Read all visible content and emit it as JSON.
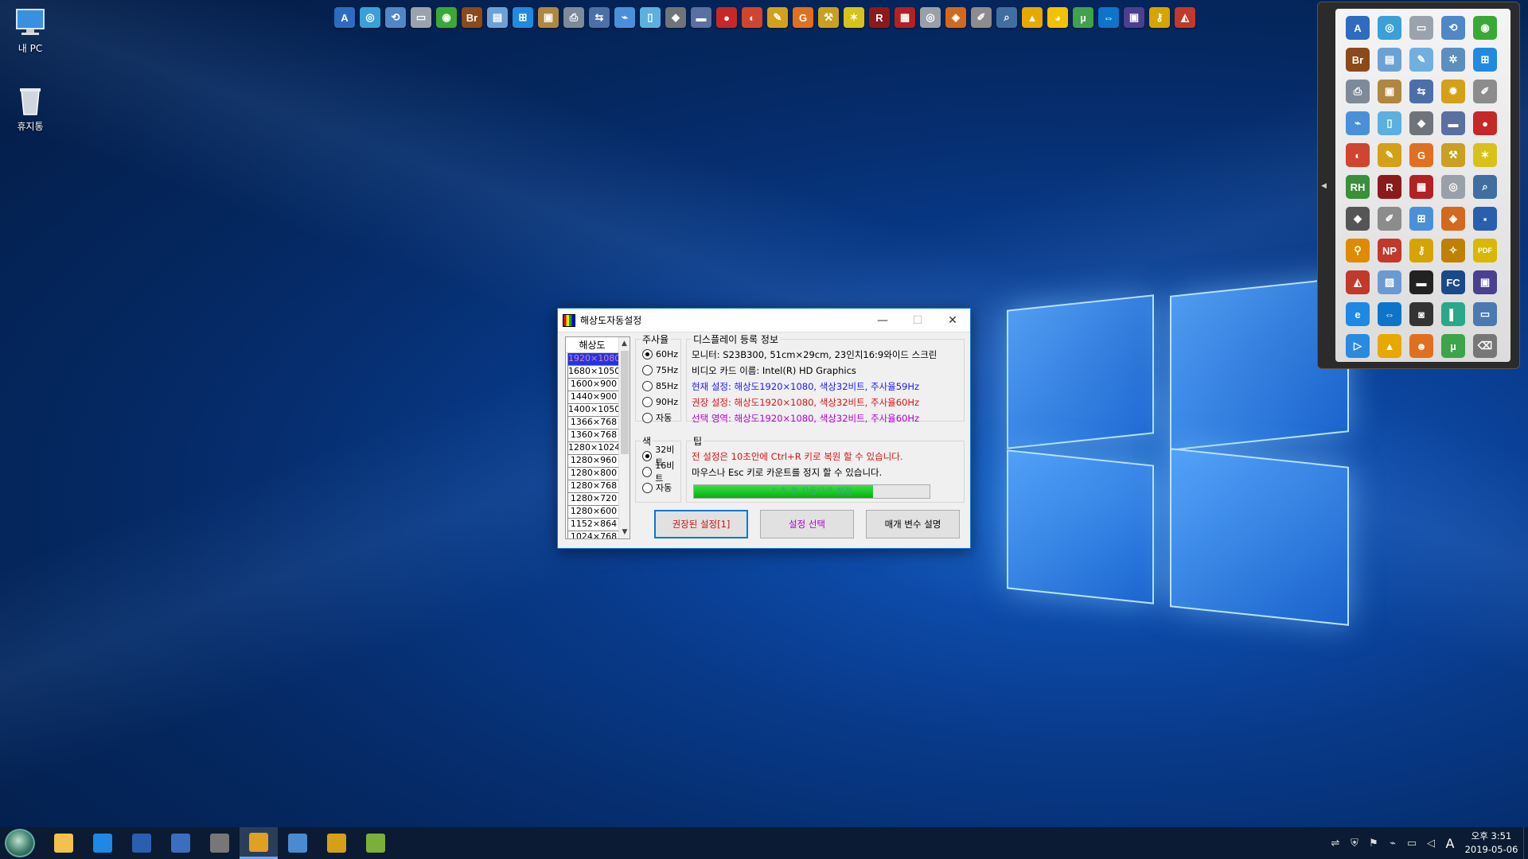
{
  "desktop": {
    "icons": [
      {
        "label": "내 PC",
        "icon": "computer-icon"
      },
      {
        "label": "휴지통",
        "icon": "recycle-bin-icon"
      }
    ]
  },
  "quicklaunch": {
    "icons": [
      {
        "icon": "a-app-icon",
        "glyph": "A",
        "color": "#2d6cc0"
      },
      {
        "icon": "disk-icon",
        "glyph": "◎",
        "color": "#3aa0d8"
      },
      {
        "icon": "backup-icon",
        "glyph": "⟲",
        "color": "#4f87c7"
      },
      {
        "icon": "drive-icon",
        "glyph": "▭",
        "color": "#9aa3ad"
      },
      {
        "icon": "hdd-green-icon",
        "glyph": "◉",
        "color": "#39a936"
      },
      {
        "icon": "bridge-icon",
        "glyph": "Br",
        "color": "#8a4a1a"
      },
      {
        "icon": "stack-icon",
        "glyph": "▤",
        "color": "#6ba2d6"
      },
      {
        "icon": "windows-icon",
        "glyph": "⊞",
        "color": "#1f8ae0"
      },
      {
        "icon": "box-icon",
        "glyph": "▣",
        "color": "#b0873f"
      },
      {
        "icon": "printer-icon",
        "glyph": "⎙",
        "color": "#7d8a99"
      },
      {
        "icon": "network-icon",
        "glyph": "⇆",
        "color": "#4c6fa8"
      },
      {
        "icon": "usb-icon",
        "glyph": "⌁",
        "color": "#4a90d9"
      },
      {
        "icon": "page-icon",
        "glyph": "▯",
        "color": "#5ab0e0"
      },
      {
        "icon": "diamond-icon",
        "glyph": "◆",
        "color": "#6f747a"
      },
      {
        "icon": "monitor-icon",
        "glyph": "▬",
        "color": "#5970a0"
      },
      {
        "icon": "ladybug-icon",
        "glyph": "●",
        "color": "#c62828"
      },
      {
        "icon": "parrot-icon",
        "glyph": "◐",
        "color": "#d0452f"
      },
      {
        "icon": "tools-icon",
        "glyph": "✎",
        "color": "#d4a017"
      },
      {
        "icon": "g-app-icon",
        "glyph": "G",
        "color": "#e07020"
      },
      {
        "icon": "wrench-icon",
        "glyph": "⚒",
        "color": "#c9a020"
      },
      {
        "icon": "stars-icon",
        "glyph": "✶",
        "color": "#d8c21a"
      },
      {
        "icon": "r-app-icon",
        "glyph": "R",
        "color": "#8b1a1a"
      },
      {
        "icon": "puzzle-icon",
        "glyph": "▦",
        "color": "#b22222"
      },
      {
        "icon": "cd-icon",
        "glyph": "◎",
        "color": "#9aa0a8"
      },
      {
        "icon": "package-icon",
        "glyph": "◈",
        "color": "#d2691e"
      },
      {
        "icon": "pen-icon",
        "glyph": "✐",
        "color": "#8c8c8c"
      },
      {
        "icon": "search-disk-icon",
        "glyph": "⌕",
        "color": "#3f6fa0"
      },
      {
        "icon": "triangle-icon",
        "glyph": "▲",
        "color": "#e8a800"
      },
      {
        "icon": "pacman-icon",
        "glyph": "◕",
        "color": "#f2c200"
      },
      {
        "icon": "utorrent-icon",
        "glyph": "µ",
        "color": "#3ea34a"
      },
      {
        "icon": "teamviewer-icon",
        "glyph": "⇔",
        "color": "#0e74c9"
      },
      {
        "icon": "chip-icon",
        "glyph": "▣",
        "color": "#4b3f8f"
      },
      {
        "icon": "key-icon",
        "glyph": "⚷",
        "color": "#d6a400"
      },
      {
        "icon": "umbrella-icon",
        "glyph": "◭",
        "color": "#c0392b"
      }
    ]
  },
  "dock": {
    "icons": [
      {
        "icon": "a-app-icon",
        "glyph": "A",
        "color": "#2d6cc0"
      },
      {
        "icon": "disk-icon",
        "glyph": "◎",
        "color": "#3aa0d8"
      },
      {
        "icon": "drive-icon",
        "glyph": "▭",
        "color": "#9aa3ad"
      },
      {
        "icon": "backup-icon",
        "glyph": "⟲",
        "color": "#4f87c7"
      },
      {
        "icon": "hdd-green-icon",
        "glyph": "◉",
        "color": "#39a936"
      },
      {
        "icon": "bridge-icon",
        "glyph": "Br",
        "color": "#8a4a1a"
      },
      {
        "icon": "stack-icon",
        "glyph": "▤",
        "color": "#6ba2d6"
      },
      {
        "icon": "tools-icon",
        "glyph": "✎",
        "color": "#6fb0e0"
      },
      {
        "icon": "gear-icon",
        "glyph": "✲",
        "color": "#5a8fc0"
      },
      {
        "icon": "windows-icon",
        "glyph": "⊞",
        "color": "#1f8ae0"
      },
      {
        "icon": "printer-icon",
        "glyph": "⎙",
        "color": "#7d8a99"
      },
      {
        "icon": "box-icon",
        "glyph": "▣",
        "color": "#b0873f"
      },
      {
        "icon": "network-icon",
        "glyph": "⇆",
        "color": "#4c6fa8"
      },
      {
        "icon": "settings-icon",
        "glyph": "✹",
        "color": "#d4a017"
      },
      {
        "icon": "cleaner-icon",
        "glyph": "✐",
        "color": "#8c8c8c"
      },
      {
        "icon": "usb-icon",
        "glyph": "⌁",
        "color": "#4a90d9"
      },
      {
        "icon": "page-icon",
        "glyph": "▯",
        "color": "#5ab0e0"
      },
      {
        "icon": "diamond-icon",
        "glyph": "◆",
        "color": "#6f747a"
      },
      {
        "icon": "monitor-icon",
        "glyph": "▬",
        "color": "#5970a0"
      },
      {
        "icon": "ladybug-icon",
        "glyph": "●",
        "color": "#c62828"
      },
      {
        "icon": "parrot-icon",
        "glyph": "◐",
        "color": "#d0452f"
      },
      {
        "icon": "tools-icon",
        "glyph": "✎",
        "color": "#d4a017"
      },
      {
        "icon": "g-app-icon",
        "glyph": "G",
        "color": "#e07020"
      },
      {
        "icon": "wrench-icon",
        "glyph": "⚒",
        "color": "#c9a020"
      },
      {
        "icon": "stars-icon",
        "glyph": "✶",
        "color": "#d8c21a"
      },
      {
        "icon": "rh-app-icon",
        "glyph": "RH",
        "color": "#3a8f3a"
      },
      {
        "icon": "r-app-icon",
        "glyph": "R",
        "color": "#8b1a1a"
      },
      {
        "icon": "puzzle-icon",
        "glyph": "▦",
        "color": "#b22222"
      },
      {
        "icon": "cd-icon",
        "glyph": "◎",
        "color": "#9aa0a8"
      },
      {
        "icon": "search-disk-icon",
        "glyph": "⌕",
        "color": "#3f6fa0"
      },
      {
        "icon": "diamond-icon",
        "glyph": "◆",
        "color": "#555"
      },
      {
        "icon": "pen-icon",
        "glyph": "✐",
        "color": "#8c8c8c"
      },
      {
        "icon": "windows-icon",
        "glyph": "⊞",
        "color": "#4a90d9"
      },
      {
        "icon": "package-icon",
        "glyph": "◈",
        "color": "#d2691e"
      },
      {
        "icon": "floppy-icon",
        "glyph": "▪",
        "color": "#2a5fb0"
      },
      {
        "icon": "magnifier-icon",
        "glyph": "⚲",
        "color": "#e08a00"
      },
      {
        "icon": "np-app-icon",
        "glyph": "NP",
        "color": "#c0392b"
      },
      {
        "icon": "key-icon",
        "glyph": "⚷",
        "color": "#d6a400"
      },
      {
        "icon": "wand-icon",
        "glyph": "✧",
        "color": "#c08000"
      },
      {
        "icon": "pdf-icon",
        "glyph": "PDF",
        "color": "#d8b800"
      },
      {
        "icon": "umbrella-icon",
        "glyph": "◭",
        "color": "#c0392b"
      },
      {
        "icon": "photo-icon",
        "glyph": "▨",
        "color": "#6b9ad0"
      },
      {
        "icon": "screen-icon",
        "glyph": "▬",
        "color": "#222"
      },
      {
        "icon": "fc-app-icon",
        "glyph": "FC",
        "color": "#1a4a8a"
      },
      {
        "icon": "chip-icon",
        "glyph": "▣",
        "color": "#4b3f8f"
      },
      {
        "icon": "ie-icon",
        "glyph": "e",
        "color": "#1e88e5"
      },
      {
        "icon": "teamviewer-icon",
        "glyph": "⇔",
        "color": "#0e74c9"
      },
      {
        "icon": "camera-icon",
        "glyph": "◙",
        "color": "#333"
      },
      {
        "icon": "panel-icon",
        "glyph": "▌",
        "color": "#2aa88a"
      },
      {
        "icon": "remote-desktop-icon",
        "glyph": "▭",
        "color": "#4a7ab0"
      },
      {
        "icon": "play-icon",
        "glyph": "▷",
        "color": "#2a8ae0"
      },
      {
        "icon": "triangle-icon",
        "glyph": "▲",
        "color": "#e8a800"
      },
      {
        "icon": "face-icon",
        "glyph": "☻",
        "color": "#e07020"
      },
      {
        "icon": "utorrent-icon",
        "glyph": "µ",
        "color": "#3ea34a"
      },
      {
        "icon": "trash-icon",
        "glyph": "⌫",
        "color": "#777"
      }
    ]
  },
  "dialog": {
    "title": "해상도자동설정",
    "resolution_header": "해상도",
    "resolutions": [
      "1920×1080",
      "1680×1050",
      "1600×900",
      "1440×900",
      "1400×1050",
      "1366×768",
      "1360×768",
      "1280×1024",
      "1280×960",
      "1280×800",
      "1280×768",
      "1280×720",
      "1280×600",
      "1152×864",
      "1024×768"
    ],
    "selected_resolution": "1920×1080",
    "refresh": {
      "label": "주사율",
      "options": [
        {
          "label": "60Hz",
          "checked": true
        },
        {
          "label": "75Hz",
          "checked": false
        },
        {
          "label": "85Hz",
          "checked": false
        },
        {
          "label": "90Hz",
          "checked": false
        },
        {
          "label": "자동",
          "checked": false
        }
      ]
    },
    "color": {
      "label": "색",
      "options": [
        {
          "label": "32비트",
          "checked": true
        },
        {
          "label": "16비트",
          "checked": false
        },
        {
          "label": "자동",
          "checked": false
        }
      ]
    },
    "display_info": {
      "label": "디스플레이 등록 정보",
      "monitor": "모니터: S23B300, 51cm×29cm, 23인치16:9와이드 스크린",
      "video_card": "비디오 카드 이름: Intel(R) HD Graphics",
      "current": "현재 설정: 해상도1920×1080, 색상32비트, 주사율59Hz",
      "recommended": "권장 설정: 해상도1920×1080, 색상32비트, 주사율60Hz",
      "selected": "선택 영역: 해상도1920×1080, 색상32비트, 주사율60Hz",
      "current_color": "#1a1aff",
      "recommended_color": "#e01010",
      "selected_color": "#b000d0"
    },
    "tip": {
      "label": "팁",
      "line1": "전 설정은 10초안에 Ctrl+R 키로 복원 할 수 있습니다.",
      "line2": "마우스나 Esc 키로 카운트를 정지 할 수 있습니다.",
      "progress_text": "1 초 후 자동으로 설정",
      "progress_fraction": 0.76,
      "line1_color": "#e01010"
    },
    "buttons": {
      "recommended": "권장된 설정[1]",
      "select": "설정 선택",
      "params": "매개 변수 설명"
    },
    "button_colors": {
      "recommended": "#d01010",
      "select": "#b000d0",
      "params": "#000000"
    }
  },
  "taskbar": {
    "apps": [
      {
        "icon": "file-explorer-icon",
        "color": "#f2c14e"
      },
      {
        "icon": "ie-icon",
        "color": "#1e88e5"
      },
      {
        "icon": "floppy-icon",
        "color": "#2a5fb0"
      },
      {
        "icon": "network-config-icon",
        "color": "#3a6fc0"
      },
      {
        "icon": "camera-icon",
        "color": "#777"
      },
      {
        "icon": "resolution-app-icon",
        "color": "#e0a020"
      },
      {
        "icon": "remote-desktop-icon",
        "color": "#4a8ad0"
      },
      {
        "icon": "r-app-icon",
        "color": "#d4a017"
      },
      {
        "icon": "cherry-icon",
        "color": "#7ab03a"
      }
    ],
    "tray_icons": [
      "network-share-icon",
      "shield-icon",
      "flag-icon",
      "usb-icon",
      "network-icon",
      "volume-icon"
    ],
    "ime": "A",
    "time": "오후 3:51",
    "date": "2019-05-06"
  }
}
